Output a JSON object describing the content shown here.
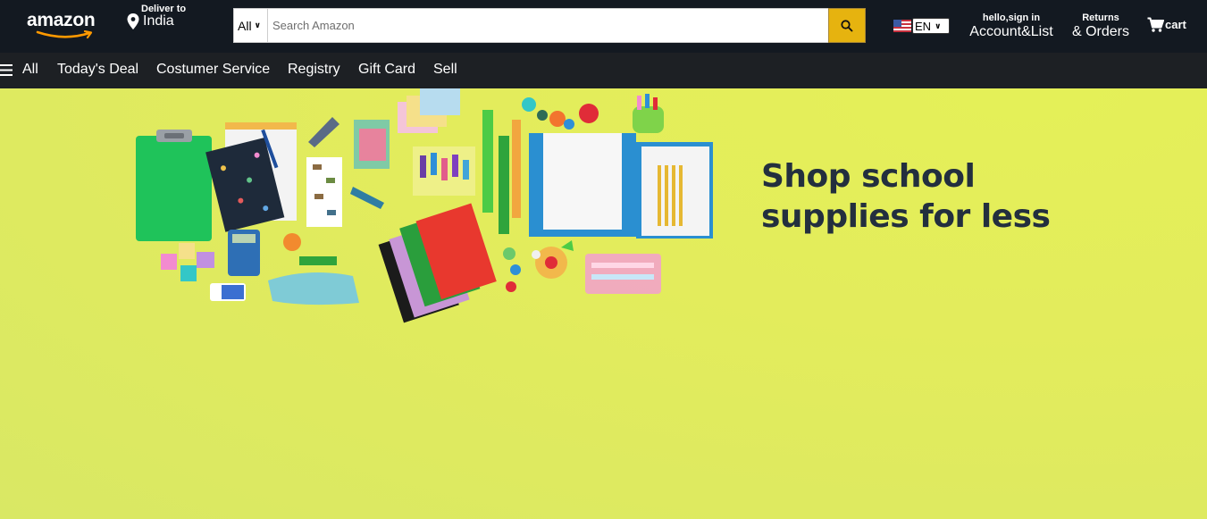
{
  "header": {
    "logo_text": "amazon",
    "deliver_label": "Deliver to",
    "deliver_location": "India",
    "search": {
      "category": "All",
      "placeholder": "Search Amazon"
    },
    "language": "EN",
    "account_greeting": "hello,sign in",
    "account_label": "Account&List",
    "returns_label": "Returns",
    "orders_label": "& Orders",
    "cart_label": "cart"
  },
  "subnav": {
    "items": [
      {
        "label": "All"
      },
      {
        "label": "Today's Deal"
      },
      {
        "label": "Costumer Service"
      },
      {
        "label": "Registry"
      },
      {
        "label": "Gift Card"
      },
      {
        "label": "Sell"
      }
    ]
  },
  "hero": {
    "title_line1": "Shop school",
    "title_line2": "supplies for less"
  },
  "colors": {
    "header_bg": "#131921",
    "subnav_bg": "#1d2024",
    "search_button": "#e6b30f",
    "hero_bg": "#e3ec58",
    "hero_text": "#232f3e"
  }
}
